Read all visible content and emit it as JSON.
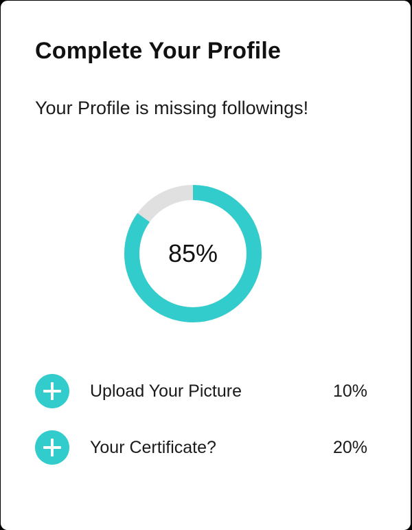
{
  "card": {
    "title": "Complete Your Profile",
    "subtitle": "Your Profile is missing followings!"
  },
  "progress": {
    "value": 0.85,
    "label": "85%",
    "fill_color": "#33cccc",
    "track_color": "#e0e0e0"
  },
  "tasks": [
    {
      "label": "Upload Your Picture",
      "percent": "10%",
      "icon": "plus-icon"
    },
    {
      "label": "Your Certificate?",
      "percent": "20%",
      "icon": "plus-icon"
    }
  ],
  "colors": {
    "accent": "#33cccc",
    "background": "#ffffff",
    "frame": "#000000",
    "text": "#111111"
  }
}
